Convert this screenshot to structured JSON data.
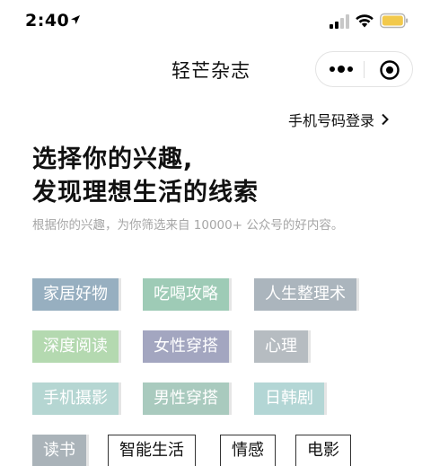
{
  "status_bar": {
    "time": "2:40",
    "battery_color": "#f2c94c",
    "icons": [
      "location-arrow-icon",
      "signal-icon",
      "wifi-icon",
      "battery-icon"
    ]
  },
  "nav": {
    "title": "轻芒杂志",
    "capsule_icons": [
      "more-icon",
      "close-icon"
    ]
  },
  "login": {
    "label": "手机号码登录"
  },
  "headline": {
    "line1": "选择你的兴趣,",
    "line2": "发现理想生活的线索",
    "subtitle": "根据你的兴趣，为你筛选来自 10000+ 公众号的好内容。"
  },
  "tags": [
    {
      "label": "家居好物",
      "color": "#97afc0",
      "selected": true
    },
    {
      "label": "吃喝攻略",
      "color": "#9ecbb6",
      "selected": true
    },
    {
      "label": "人生整理术",
      "color": "#abb5bd",
      "selected": true
    },
    {
      "label": "深度阅读",
      "color": "#b4d9b0",
      "selected": true
    },
    {
      "label": "女性穿搭",
      "color": "#a3a6c0",
      "selected": true
    },
    {
      "label": "心理",
      "color": "#b6bcc1",
      "selected": true
    },
    {
      "label": "手机摄影",
      "color": "#b5d6d2",
      "selected": true
    },
    {
      "label": "男性穿搭",
      "color": "#a9cabe",
      "selected": true
    },
    {
      "label": "日韩剧",
      "color": "#b3d6d5",
      "selected": true
    },
    {
      "label": "读书",
      "color": "#aab3b9",
      "selected": true
    },
    {
      "label": "智能生活",
      "color": "#ffffff",
      "selected": false
    },
    {
      "label": "情感",
      "color": "#ffffff",
      "selected": false
    },
    {
      "label": "电影",
      "color": "#ffffff",
      "selected": false
    }
  ]
}
